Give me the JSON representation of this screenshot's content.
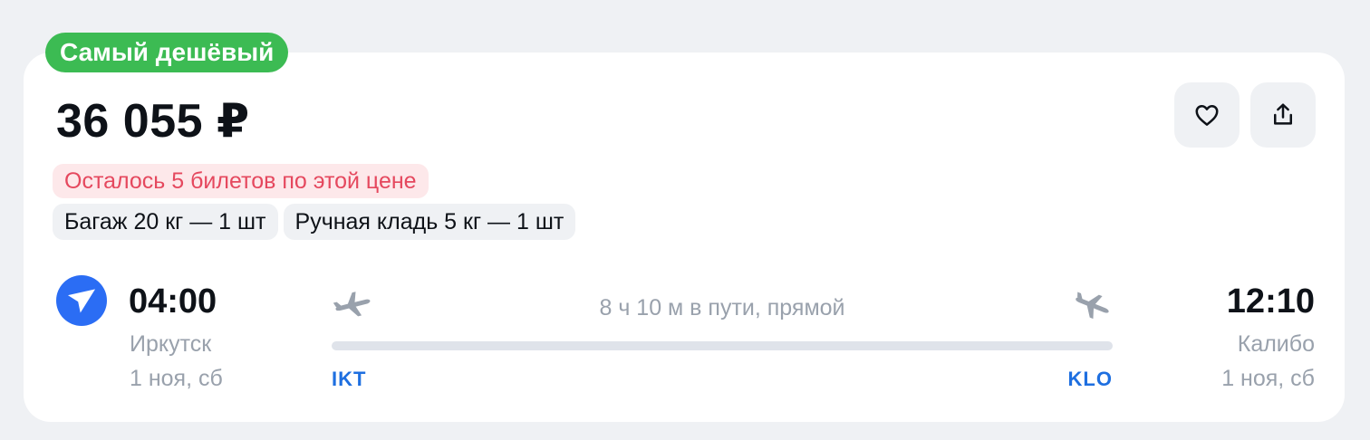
{
  "badge": {
    "label": "Самый дешёвый",
    "color": "#3cbb53"
  },
  "price": "36 055 ₽",
  "actions": {
    "favorite_icon": "heart-icon",
    "share_icon": "share-icon"
  },
  "availability": {
    "text": "Осталось 5 билетов по этой цене",
    "color": "#e5485e"
  },
  "baggage_chips": [
    "Багаж 20 кг — 1 шт",
    "Ручная кладь 5 кг — 1 шт"
  ],
  "airline": {
    "logo_icon": "paper-plane-logo",
    "color": "#2b6df4"
  },
  "flight": {
    "departure": {
      "time": "04:00",
      "city": "Иркутск",
      "date": "1 ноя, сб",
      "iata": "IKT"
    },
    "arrival": {
      "time": "12:10",
      "city": "Калибо",
      "date": "1 ноя, сб",
      "iata": "KLO"
    },
    "duration_text": "8 ч 10 м в пути, прямой"
  },
  "colors": {
    "accent_blue": "#1e6fe0",
    "muted_text": "#99a1ac",
    "background": "#eff1f4"
  }
}
